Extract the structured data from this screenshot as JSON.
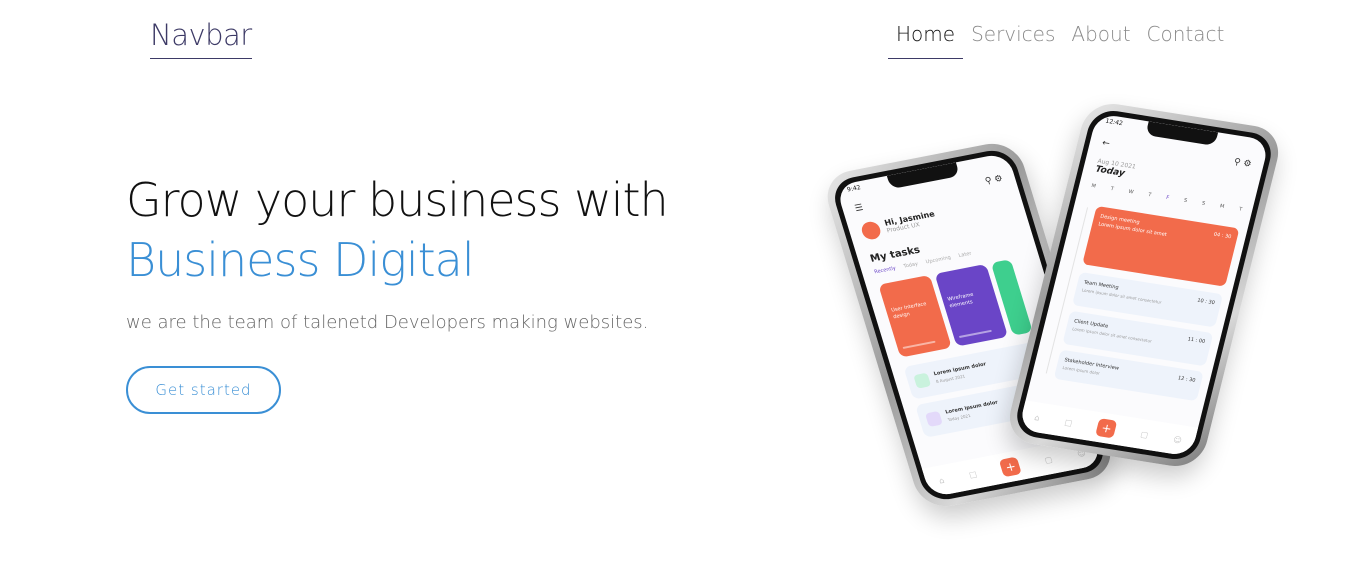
{
  "navbar": {
    "brand": "Navbar",
    "links": [
      {
        "label": "Home",
        "active": true
      },
      {
        "label": "Services",
        "active": false
      },
      {
        "label": "About",
        "active": false
      },
      {
        "label": "Contact",
        "active": false
      }
    ]
  },
  "hero": {
    "title_line1": "Grow your business with",
    "title_line2": "Business Digital",
    "subtitle": "we are the team of talenetd Developers making websites.",
    "cta_label": "Get started"
  },
  "colors": {
    "accent": "#3a8fd5",
    "brand": "#3d3a66",
    "app_orange": "#f26b4b",
    "app_purple": "#6a45c7",
    "app_green": "#3ecf8e"
  },
  "mockup": {
    "left_phone": {
      "time": "9:42",
      "greeting": "Hi, Jasmine",
      "greeting_sub": "Product UX",
      "section": "My tasks",
      "tabs": [
        "Recently",
        "Today",
        "Upcoming",
        "Later"
      ],
      "cards": [
        {
          "title": "User Interface design",
          "color": "#f26b4b"
        },
        {
          "title": "Wireframe elements",
          "color": "#6a45c7"
        },
        {
          "title": "",
          "color": "#3ecf8e"
        }
      ],
      "list": [
        {
          "title": "Lorem ipsum dolor",
          "sub": "8 August 2021",
          "color": "#3ecf8e"
        },
        {
          "title": "Lorem ipsum dolor",
          "sub": "Today 2021",
          "color": "#b9a6e8"
        }
      ]
    },
    "right_phone": {
      "time": "12:42",
      "date_small": "Aug 10 2021",
      "date_big": "Today",
      "week": [
        "M",
        "T",
        "W",
        "T",
        "F",
        "S",
        "S",
        "M",
        "T"
      ],
      "events": [
        {
          "title": "Design meeting",
          "time": "04 : 30",
          "sub": "Lorem ipsum dolor sit amet"
        },
        {
          "title": "Team Meeting",
          "time": "10 : 30",
          "sub": "Lorem ipsum dolor sit amet consectetur"
        },
        {
          "title": "Client Update",
          "time": "11 : 00",
          "sub": "Lorem ipsum dolor sit amet consectetur"
        },
        {
          "title": "Stakeholder Interview",
          "time": "12 : 30",
          "sub": "Lorem ipsum dolor"
        }
      ]
    }
  }
}
